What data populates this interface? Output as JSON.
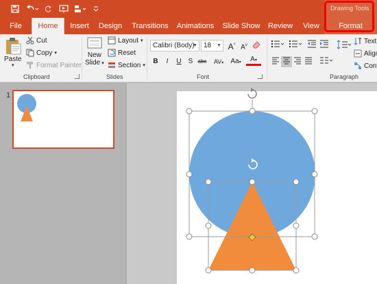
{
  "app": {
    "contextual_group": "Drawing Tools"
  },
  "tabs": [
    {
      "label": "File"
    },
    {
      "label": "Home"
    },
    {
      "label": "Insert"
    },
    {
      "label": "Design"
    },
    {
      "label": "Transitions"
    },
    {
      "label": "Animations"
    },
    {
      "label": "Slide Show"
    },
    {
      "label": "Review"
    },
    {
      "label": "View"
    },
    {
      "label": "Format"
    }
  ],
  "clipboard": {
    "paste": "Paste",
    "cut": "Cut",
    "copy": "Copy",
    "format_painter": "Format Painter",
    "group_label": "Clipboard"
  },
  "slides": {
    "new_slide_line1": "New",
    "new_slide_line2": "Slide",
    "layout": "Layout",
    "reset": "Reset",
    "section": "Section",
    "group_label": "Slides"
  },
  "font": {
    "name": "Calibri (Body)",
    "size": "18",
    "bold": "B",
    "italic": "I",
    "underline": "U",
    "shadow": "S",
    "strike": "abc",
    "spacing": "AV",
    "change_case": "Aa",
    "font_color": "A",
    "grow": "A",
    "shrink": "A",
    "group_label": "Font"
  },
  "paragraph": {
    "text_direction": "Text",
    "align_text": "Align",
    "convert": "Conv",
    "group_label": "Paragraph"
  },
  "slide_panel": {
    "slide_number": "1"
  },
  "colors": {
    "ribbon_red": "#d04a23",
    "circle_blue": "#6fa8dc",
    "triangle_orange": "#f08c3c",
    "highlight_red": "#e00000"
  }
}
